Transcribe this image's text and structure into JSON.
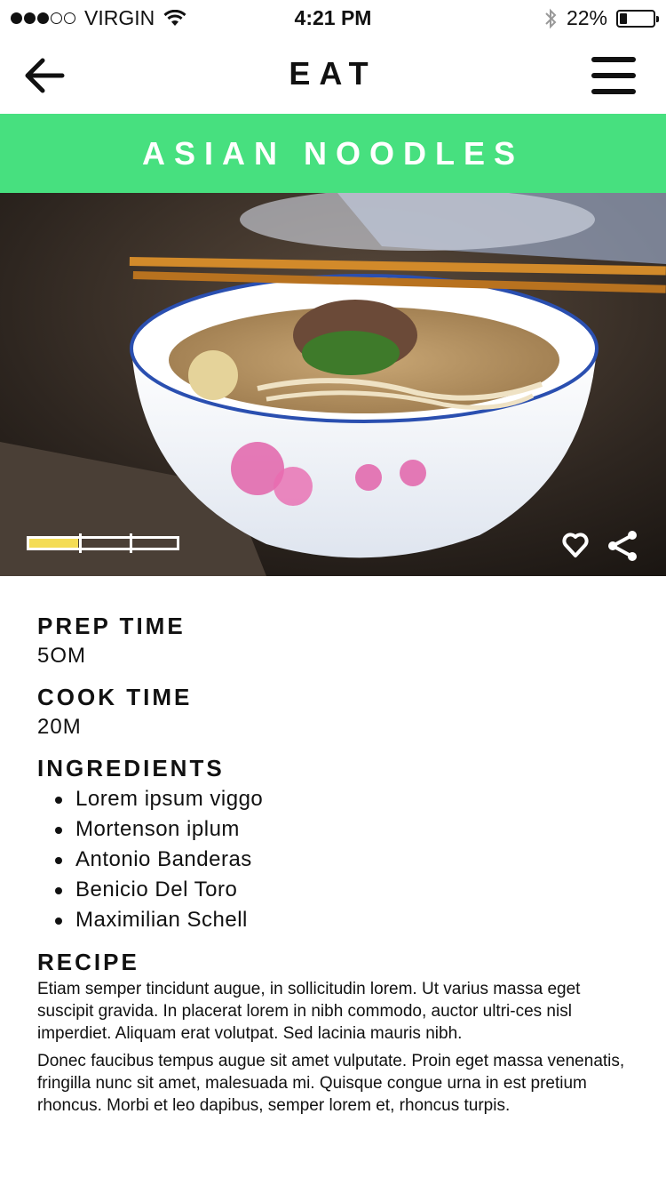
{
  "status_bar": {
    "carrier": "VIRGIN",
    "time": "4:21 PM",
    "battery_text": "22%",
    "battery_level": 0.22,
    "signal_bars_filled": 3,
    "signal_bars_total": 5
  },
  "nav": {
    "title": "EAT",
    "back_icon": "arrow-left-icon",
    "menu_icon": "hamburger-menu-icon"
  },
  "banner": {
    "title": "ASIAN NOODLES",
    "color": "#47e07f"
  },
  "hero": {
    "progress_fraction": 0.33,
    "progress_color": "#f4dc55",
    "actions": [
      "heart-icon",
      "share-icon"
    ]
  },
  "details": {
    "prep_label": "PREP TIME",
    "prep_value": "5OM",
    "cook_label": "COOK TIME",
    "cook_value": "20M",
    "ingredients_label": "INGREDIENTS",
    "ingredients": [
      "Lorem ipsum viggo",
      "Mortenson iplum",
      "Antonio Banderas",
      "Benicio Del Toro",
      "Maximilian Schell"
    ],
    "recipe_label": "RECIPE",
    "recipe_paragraphs": [
      "Etiam semper tincidunt augue, in sollicitudin lorem. Ut varius massa eget suscipit gravida. In placerat lorem in nibh commodo, auctor ultri-ces nisl imperdiet. Aliquam erat volutpat. Sed lacinia mauris nibh.",
      "Donec faucibus tempus augue sit amet vulputate. Proin eget massa venenatis, fringilla nunc sit amet, malesuada mi. Quisque congue urna in est pretium rhoncus. Morbi et leo dapibus, semper lorem et, rhoncus turpis."
    ]
  }
}
